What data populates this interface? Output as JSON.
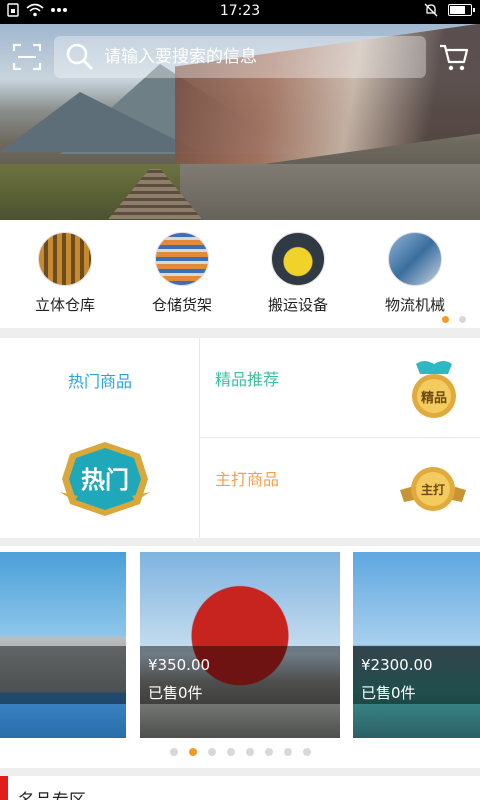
{
  "status_bar": {
    "time": "17:23",
    "left_icons": [
      "sim-icon",
      "wifi-icon",
      "more-dots-icon"
    ],
    "right_icons": [
      "mute-bell-icon",
      "battery-icon"
    ]
  },
  "header": {
    "search_placeholder": "请输入要搜索的信息",
    "icons": [
      "scan-icon",
      "search-icon",
      "cart-icon"
    ]
  },
  "categories": [
    {
      "label": "立体仓库"
    },
    {
      "label": "仓储货架"
    },
    {
      "label": "搬运设备"
    },
    {
      "label": "物流机械"
    }
  ],
  "category_pager": {
    "pages": 2,
    "active": 1
  },
  "promos": {
    "hot": {
      "title": "热门商品",
      "badge": "热门"
    },
    "featured": {
      "title": "精品推荐",
      "badge": "精品"
    },
    "main": {
      "title": "主打商品",
      "badge": "主打"
    }
  },
  "products": [
    {
      "price": "",
      "sold": ""
    },
    {
      "price": "¥350.00",
      "sold": "已售0件"
    },
    {
      "price": "¥2300.00",
      "sold": "已售0件"
    }
  ],
  "product_pager": {
    "pages": 8,
    "active": 2
  },
  "section": {
    "title": "名品专区"
  },
  "colors": {
    "accent_orange": "#f39a23",
    "hot_blue": "#2aa4e0",
    "featured_green": "#3dbfa0",
    "main_orange": "#f6a04d",
    "section_red": "#e21b1b"
  }
}
